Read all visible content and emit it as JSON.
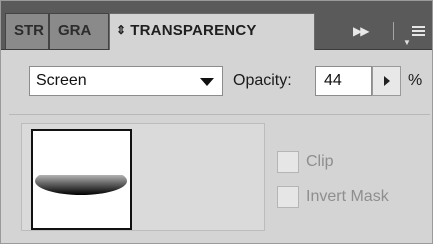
{
  "tabs": [
    {
      "label": "STR",
      "active": false
    },
    {
      "label": "GRA",
      "active": false
    },
    {
      "label": "TRANSPARENCY",
      "active": true
    }
  ],
  "tab_prefix_icon": "updown-arrows",
  "strip": {
    "forward_icon": "double-chevron-right-icon",
    "menu_icon": "panel-menu-icon"
  },
  "blend_mode": {
    "value": "Screen"
  },
  "opacity": {
    "label": "Opacity:",
    "value": "44",
    "unit": "%"
  },
  "mask_options": {
    "clip_label": "Clip",
    "clip_checked": false,
    "invert_label": "Invert Mask",
    "invert_checked": false
  },
  "colors": {
    "tab_strip": "#5a5a5a",
    "panel": "#d4d4d4",
    "disabled_text": "#8e8e8e"
  }
}
